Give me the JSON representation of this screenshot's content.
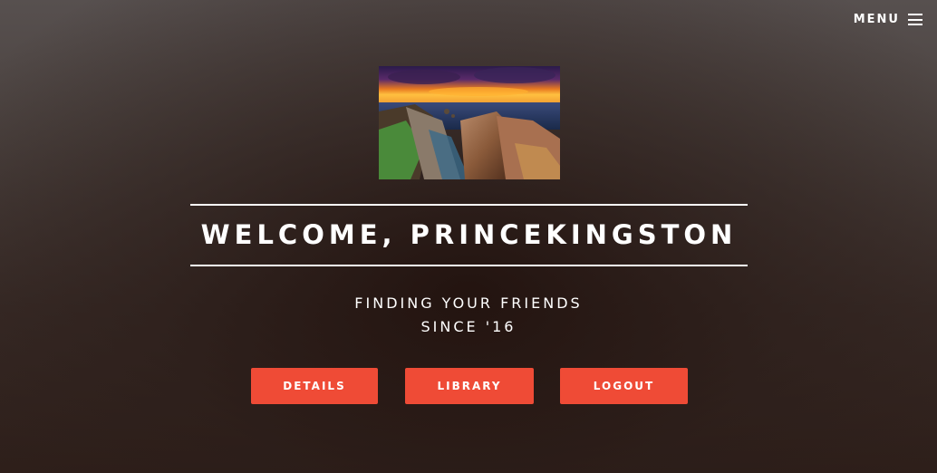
{
  "nav": {
    "menu_label": "MENU"
  },
  "hero": {
    "title": "WELCOME, PRINCEKINGSTON",
    "tagline_line1": "FINDING YOUR FRIENDS",
    "tagline_line2": "SINCE '16"
  },
  "buttons": {
    "details_label": "DETAILS",
    "library_label": "LIBRARY",
    "logout_label": "LOGOUT"
  },
  "colors": {
    "accent": "#ef4b36",
    "text": "#ffffff"
  },
  "icons": {
    "menu": "hamburger-icon"
  }
}
